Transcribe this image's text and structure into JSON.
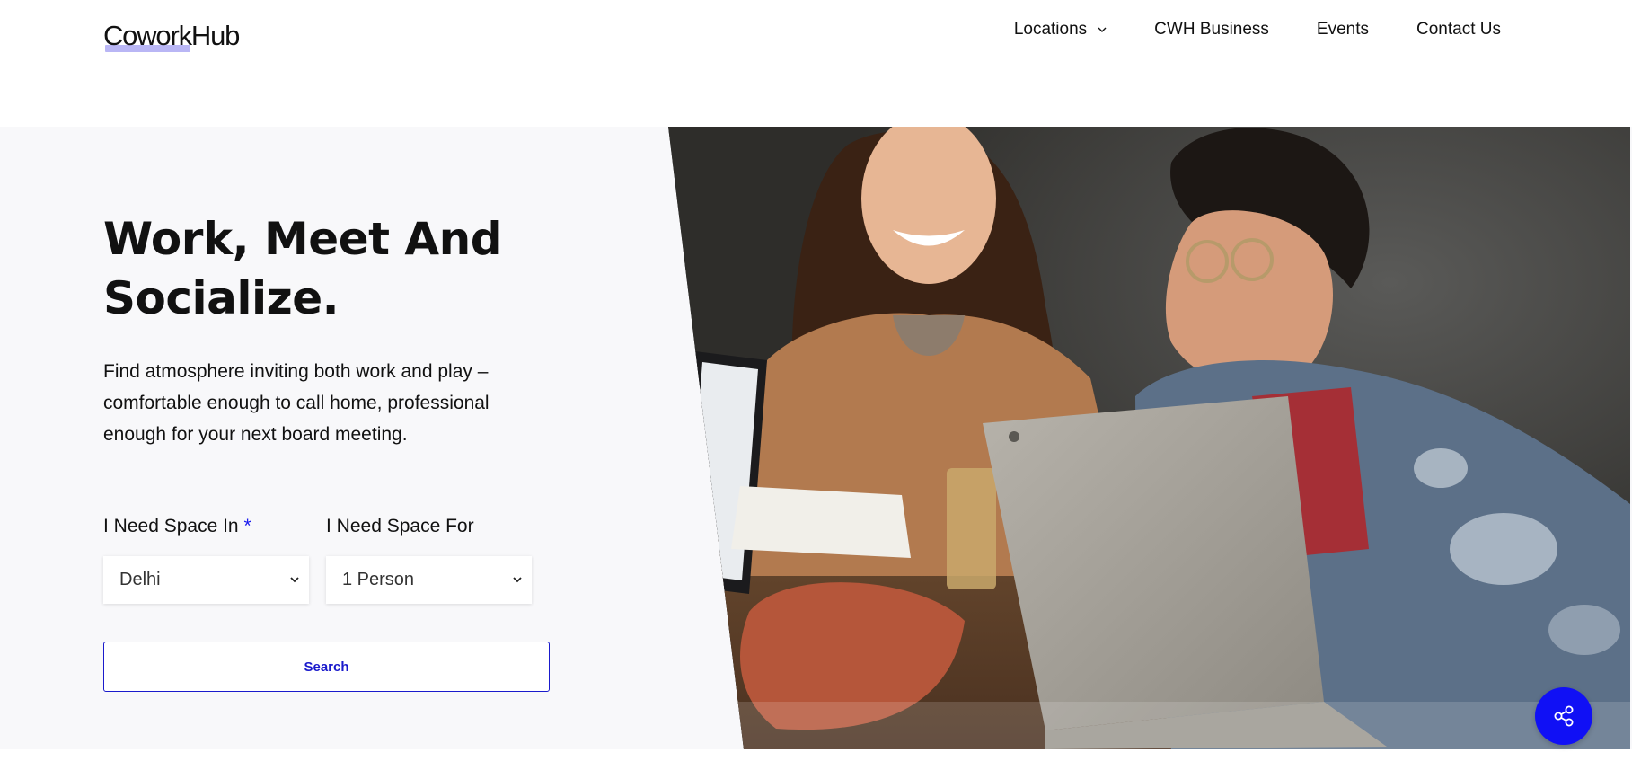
{
  "header": {
    "logo": "CoworkHub",
    "nav": [
      {
        "label": "Locations",
        "has_dropdown": true
      },
      {
        "label": "CWH Business"
      },
      {
        "label": "Events"
      },
      {
        "label": "Contact Us"
      }
    ]
  },
  "hero": {
    "title": "Work, Meet And Socialize.",
    "description": "Find atmosphere inviting both work and play – comfortable enough to call home, professional enough for your next board meeting.",
    "image_alt": "",
    "space_in": {
      "label": "I Need Space In",
      "required_mark": "*",
      "selected": "Delhi"
    },
    "space_for": {
      "label": "I Need Space For",
      "selected": "1 Person"
    },
    "search_label": "Search"
  },
  "share": {
    "icon": "share-icon"
  },
  "colors": {
    "accent": "#1010f5",
    "button_text": "#1a1acc",
    "logo_underline": "#b9b6f5",
    "hero_bg": "#f8f8fa"
  }
}
